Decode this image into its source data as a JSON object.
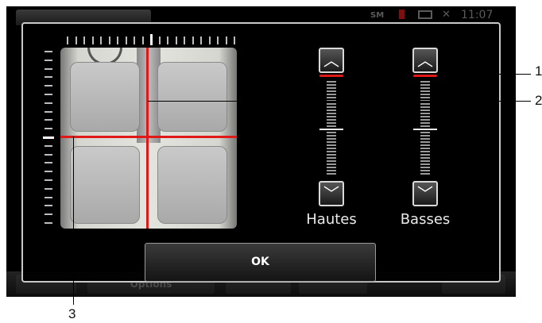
{
  "status_bar": {
    "signal_label": "SM",
    "clock": "11:07"
  },
  "bottom_bar": {
    "options_label": "Options"
  },
  "balance": {
    "horizontal_ticks": 21,
    "vertical_ticks": 21
  },
  "sliders": {
    "hautes": {
      "label": "Hautes",
      "up_symbol": "^",
      "down_symbol": "v"
    },
    "basses": {
      "label": "Basses",
      "up_symbol": "^",
      "down_symbol": "v"
    }
  },
  "ok_button": {
    "label": "OK"
  },
  "callouts": {
    "one": "1",
    "two": "2",
    "three": "3"
  },
  "colors": {
    "accent_red": "#e01818",
    "frame": "#c9c9c9"
  }
}
